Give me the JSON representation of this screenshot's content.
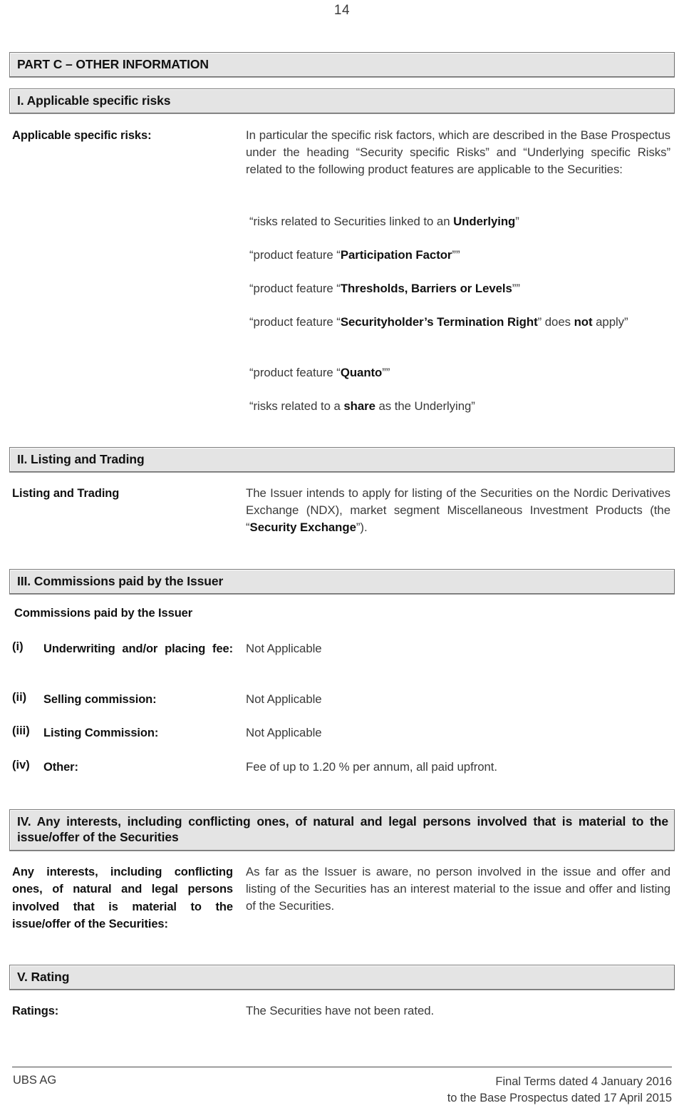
{
  "page": {
    "number": "14"
  },
  "part_header": {
    "label": "PART C – OTHER INFORMATION"
  },
  "sections": {
    "risks": {
      "header": "I. Applicable specific risks",
      "label": "Applicable specific risks:",
      "intro": "In particular the specific risk factors, which are described in the Base Prospectus under the heading “Security specific Risks” and “Underlying specific Risks” related to the following product features are applicable to the Securities:",
      "features": [
        {
          "prefix": "“risks related to Securities linked to an ",
          "bold": "Underlying",
          "suffix": "”"
        },
        {
          "prefix": "“product feature “",
          "bold": "Participation Factor",
          "suffix": "””"
        },
        {
          "prefix": "“product feature “",
          "bold": "Thresholds, Barriers or Levels",
          "suffix": "””"
        },
        {
          "prefix": "“product feature “",
          "bold": "Securityholder’s Termination Right",
          "suffix": "” does ",
          "bold2": "not",
          "suffix2": " apply”"
        },
        {
          "prefix": "“product feature “",
          "bold": "Quanto",
          "suffix": "””"
        },
        {
          "prefix": "“risks related to a ",
          "bold": "share",
          "suffix": " as the Underlying”"
        }
      ]
    },
    "listing": {
      "header": "II. Listing and Trading",
      "label": "Listing and Trading",
      "body_prefix": "The Issuer intends to apply for listing of the Securities on the Nordic Derivatives Exchange (NDX), market segment Miscellaneous Investment Products (the “",
      "body_bold": "Security Exchange",
      "body_suffix": "”)."
    },
    "commissions": {
      "header": "III. Commissions paid by the Issuer",
      "title": "Commissions paid by the Issuer",
      "items": [
        {
          "num": "(i)",
          "label": "Underwriting and/or placing fee:",
          "value": "Not Applicable"
        },
        {
          "num": "(ii)",
          "label": "Selling commission:",
          "value": "Not Applicable"
        },
        {
          "num": "(iii)",
          "label": "Listing Commission:",
          "value": "Not Applicable"
        },
        {
          "num": "(iv)",
          "label": "Other:",
          "value": "Fee of up to 1.20 % per annum, all paid upfront."
        }
      ]
    },
    "interests": {
      "header": "IV. Any interests, including conflicting ones, of natural and legal persons involved that is material to the issue/offer of the Securities",
      "label": "Any interests, including conflicting ones, of natural and legal persons involved that is material to the issue/offer of the Securities:",
      "body": "As far as the Issuer is aware, no person involved in the issue and offer and listing of the Securities has an interest material to the issue and offer and listing of the Securities."
    },
    "rating": {
      "header": "V. Rating",
      "label": "Ratings:",
      "body": "The Securities have not been rated."
    }
  },
  "footer": {
    "left": "UBS AG",
    "right_line1": "Final Terms dated 4 January 2016",
    "right_line2": "to the Base Prospectus dated 17 April 2015"
  }
}
